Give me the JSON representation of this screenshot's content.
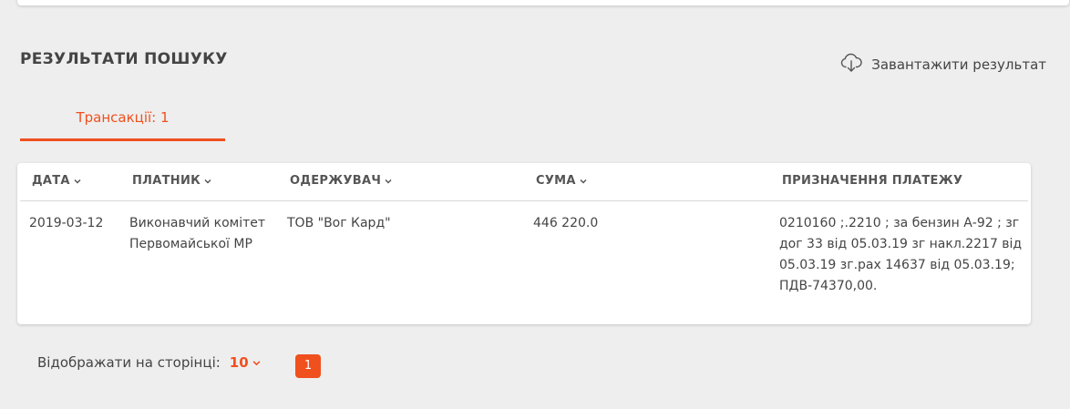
{
  "section": {
    "title": "РЕЗУЛЬТАТИ ПОШУКУ",
    "download_label": "Завантажити результат",
    "download_icon": "cloud-download-icon"
  },
  "tabs": [
    {
      "label": "Трансакції: 1",
      "active": true
    }
  ],
  "table": {
    "columns": [
      {
        "label": "ДАТА",
        "sortable": true
      },
      {
        "label": "ПЛАТНИК",
        "sortable": true
      },
      {
        "label": "ОДЕРЖУВАЧ",
        "sortable": true
      },
      {
        "label": "СУМА",
        "sortable": true
      },
      {
        "label": "ПРИЗНАЧЕННЯ ПЛАТЕЖУ",
        "sortable": false
      }
    ],
    "rows": [
      {
        "date": "2019-03-12",
        "payer": "Виконавчий комітет Первомайської МР",
        "recipient": "ТОВ \"Вог Кард\"",
        "amount": "446 220.0",
        "purpose": "0210160 ;.2210 ; за бензин А-92 ; зг дог 33 від 05.03.19 зг накл.2217 від 05.03.19 зг.рах 14637 від 05.03.19; ПДВ-74370,00."
      }
    ]
  },
  "pagination": {
    "per_page_label": "Відображати на сторінці:",
    "per_page_value": "10",
    "current_page": "1"
  },
  "colors": {
    "accent": "#f0501e",
    "background": "#eeeeee",
    "card": "#ffffff"
  }
}
